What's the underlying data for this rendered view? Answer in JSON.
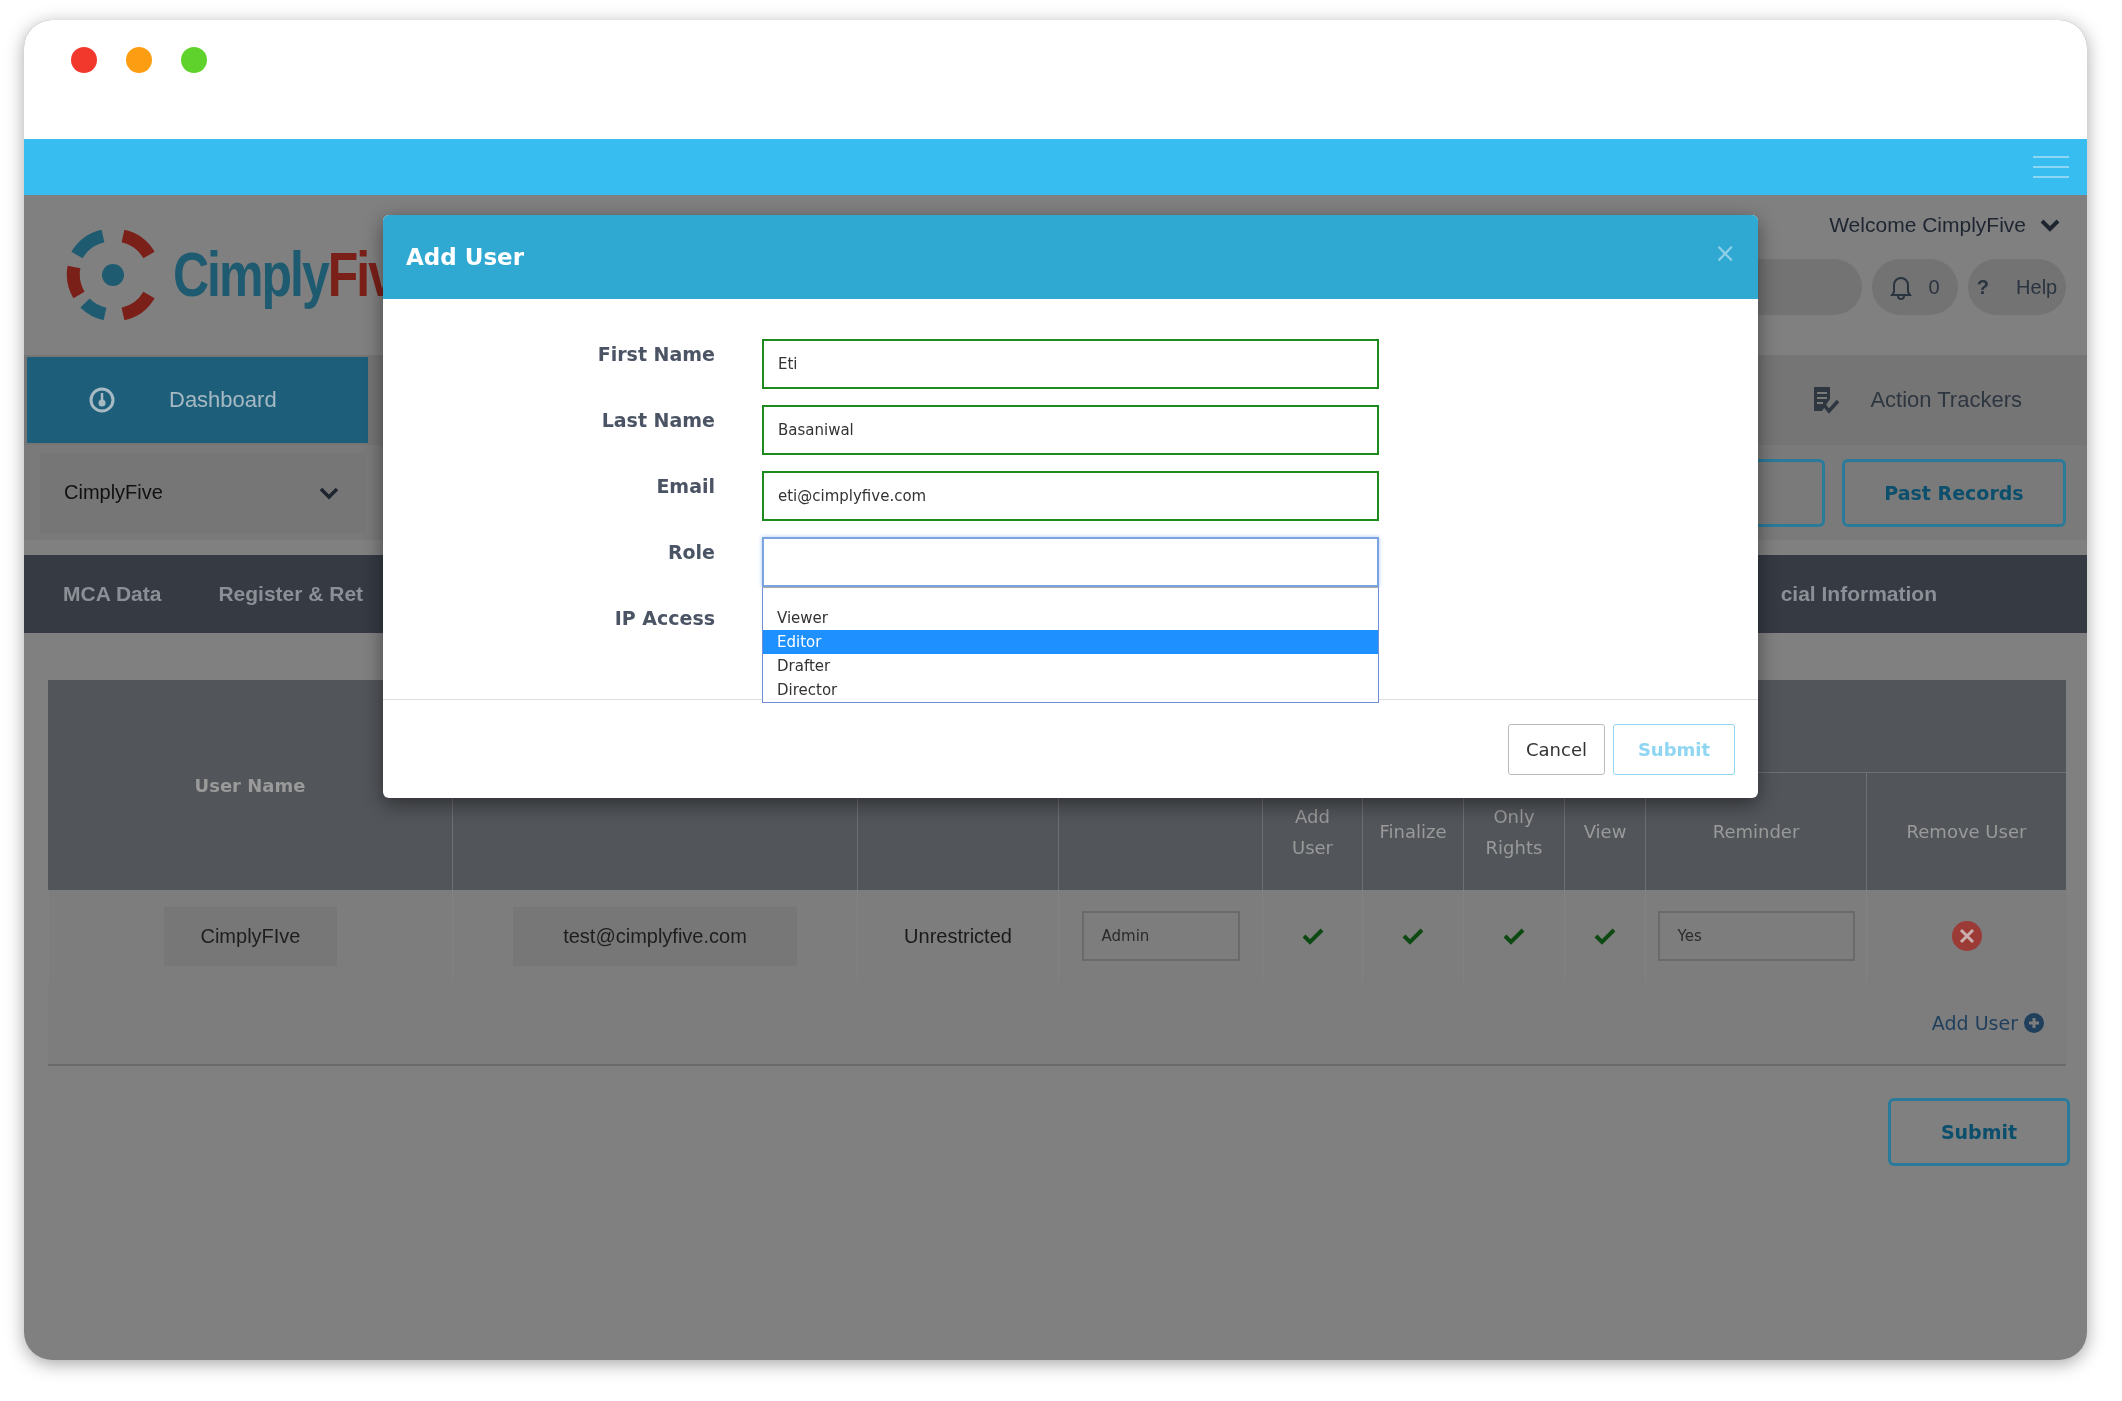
{
  "header": {
    "logo": {
      "main": "Cimply",
      "accent": "Fiv"
    },
    "welcome": "Welcome CimplyFive",
    "notifications": "0",
    "help_icon": "?",
    "help": "Help"
  },
  "nav": [
    {
      "label": "Dashboard",
      "selected": true
    },
    {
      "label": "Action Trackers",
      "selected": false
    }
  ],
  "company_select": {
    "value": "CimplyFive"
  },
  "past_records": "Past Records",
  "menu": [
    "MCA Data",
    "Register & Ret",
    "cial Information"
  ],
  "table": {
    "columns": [
      "User Name",
      "Add User",
      "Finalize",
      "Only Rights",
      "View",
      "Reminder",
      "Remove User"
    ],
    "rows": [
      {
        "user_name": "CimplyFIve",
        "email": "test@cimplyfive.com",
        "ip_access": "Unrestricted",
        "role": "Admin",
        "add_user": true,
        "finalize": true,
        "save_only_rights": true,
        "view": true,
        "reminder": "Yes"
      }
    ]
  },
  "add_user_link": "Add User",
  "submit": "Submit",
  "modal": {
    "title": "Add User",
    "close": "×",
    "fields": [
      {
        "label": "First Name",
        "kind": "text",
        "value": "Eti"
      },
      {
        "label": "Last Name",
        "kind": "text",
        "value": "Basaniwal"
      },
      {
        "label": "Email",
        "kind": "text",
        "value": "eti@cimplyfive.com"
      },
      {
        "label": "Role",
        "kind": "select",
        "options": [
          {
            "label": "Viewer",
            "selected": false
          },
          {
            "label": "Editor",
            "selected": true
          },
          {
            "label": "Drafter",
            "selected": false
          },
          {
            "label": "Director",
            "selected": false
          }
        ]
      },
      {
        "label": "IP Access",
        "kind": "hidden"
      }
    ],
    "buttons": [
      {
        "label": "Cancel",
        "kind": "secondary"
      },
      {
        "label": "Submit",
        "kind": "primary"
      }
    ]
  }
}
